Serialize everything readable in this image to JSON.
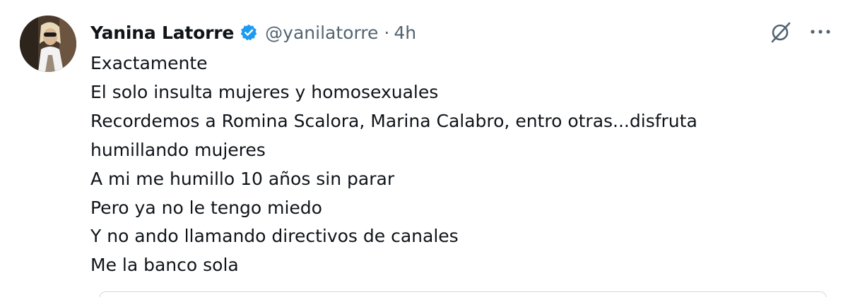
{
  "tweet": {
    "author": {
      "display_name": "Yanina Latorre",
      "handle": "@yanilatorre",
      "verified": true
    },
    "separator": "·",
    "time": "4h",
    "lines": [
      "Exactamente",
      "El solo insulta mujeres y homosexuales",
      "Recordemos a Romina Scalora, Marina Calabro, entro otras...disfruta",
      "humillando mujeres",
      "A mi me humillo 10 años sin parar",
      "Pero ya no le tengo miedo",
      "Y no ando llamando directivos de canales",
      "Me la banco sola"
    ]
  },
  "icons": {
    "verified": "verified-badge-icon",
    "grok": "grok-icon",
    "more": "more-horizontal-icon"
  },
  "colors": {
    "text": "#0f1419",
    "secondary_text": "#536471",
    "verified_blue": "#1d9bf0",
    "border": "#cfd9de"
  }
}
